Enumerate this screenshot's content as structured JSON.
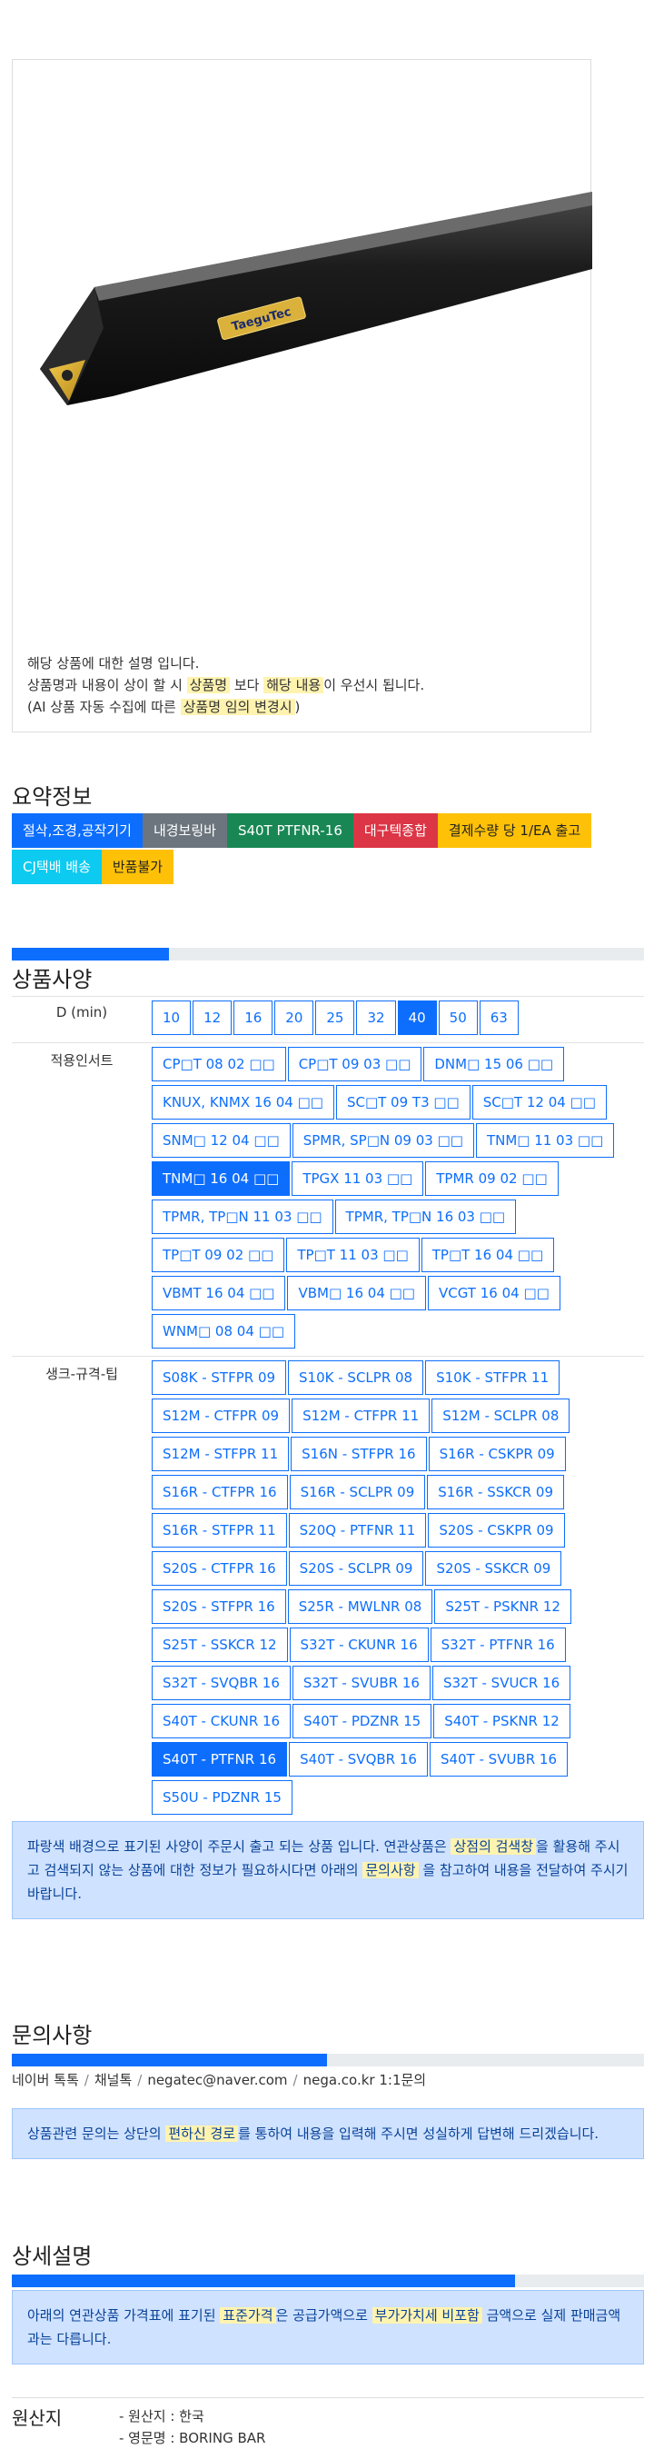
{
  "product": {
    "brand": "TaeguTec",
    "desc_line1": "해당 상품에 대한 설명 입니다.",
    "desc_line2_a": "상품명과 내용이 상이 할 시",
    "desc_line2_hl1": "상품명",
    "desc_line2_b": "보다",
    "desc_line2_hl2": "해당 내용",
    "desc_line2_c": "이 우선시 됩니다.",
    "desc_line3_a": "(AI 상품 자동 수집에 따른",
    "desc_line3_hl": "상품명 임의 변경시",
    "desc_line3_b": ")"
  },
  "summary": {
    "title": "요약정보",
    "badges": [
      {
        "label": "절삭,조경,공작기기",
        "color": "#0d6efd"
      },
      {
        "label": "내경보링바",
        "color": "#6c757d"
      },
      {
        "label": "S40T PTFNR-16",
        "color": "#198754"
      },
      {
        "label": "대구텍종합",
        "color": "#dc3545"
      },
      {
        "label": "결제수량 당 1/EA 출고",
        "color": "#ffc107",
        "text": "#222"
      },
      {
        "label": "CJ택배 배송",
        "color": "#0dcaf0"
      },
      {
        "label": "반품불가",
        "color": "#ffc107",
        "text": "#222"
      }
    ]
  },
  "specs": {
    "title": "상품사양",
    "d_label": "D (min)",
    "d_values": [
      "10",
      "12",
      "16",
      "20",
      "25",
      "32",
      "40",
      "50",
      "63"
    ],
    "d_selected": "40",
    "insert_label": "적용인서트",
    "inserts": [
      "CP□T 08 02 □□",
      "CP□T 09 03 □□",
      "DNM□ 15 06 □□",
      "KNUX, KNMX 16 04 □□",
      "SC□T 09 T3 □□",
      "SC□T 12 04 □□",
      "SNM□ 12 04 □□",
      "SPMR, SP□N 09 03 □□",
      "TNM□ 11 03 □□",
      "TNM□ 16 04 □□",
      "TPGX 11 03 □□",
      "TPMR 09 02 □□",
      "TPMR, TP□N 11 03 □□",
      "TPMR, TP□N 16 03 □□",
      "TP□T 09 02 □□",
      "TP□T 11 03 □□",
      "TP□T 16 04 □□",
      "VBMT 16 04 □□",
      "VBM□ 16 04 □□",
      "VCGT 16 04 □□",
      "WNM□ 08 04 □□"
    ],
    "insert_selected": "TNM□ 16 04 □□",
    "shank_label": "생크-규격-팁",
    "shanks": [
      "S08K - STFPR 09",
      "S10K - SCLPR 08",
      "S10K - STFPR 11",
      "S12M - CTFPR 09",
      "S12M - CTFPR 11",
      "S12M - SCLPR 08",
      "S12M - STFPR 11",
      "S16N - STFPR 16",
      "S16R - CSKPR 09",
      "S16R - CTFPR 16",
      "S16R - SCLPR 09",
      "S16R - SSKCR 09",
      "S16R - STFPR 11",
      "S20Q - PTFNR 11",
      "S20S - CSKPR 09",
      "S20S - CTFPR 16",
      "S20S - SCLPR 09",
      "S20S - SSKCR 09",
      "S20S - STFPR 16",
      "S25R - MWLNR 08",
      "S25T - PSKNR 12",
      "S25T - SSKCR 12",
      "S32T - CKUNR 16",
      "S32T - PTFNR 16",
      "S32T - SVQBR 16",
      "S32T - SVUBR 16",
      "S32T - SVUCR 16",
      "S40T - CKUNR 16",
      "S40T - PDZNR 15",
      "S40T - PSKNR 12",
      "S40T - PTFNR 16",
      "S40T - SVQBR 16",
      "S40T - SVUBR 16",
      "S50U - PDZNR 15"
    ],
    "shank_selected": "S40T - PTFNR 16",
    "note_a": "파랑색 배경으로 표기된 사양이 주문시 출고 되는 상품 입니다. 연관상품은",
    "note_hl1": "상점의 검색창",
    "note_b": "을 활용해 주시고 검색되지 않는 상품에 대한 정보가 필요하시다면 아래의",
    "note_hl2": "문의사항",
    "note_c": "을 참고하여 내용을 전달하여 주시기 바랍니다."
  },
  "inquiry": {
    "title": "문의사항",
    "links": [
      "네이버 톡톡",
      "채널톡",
      "negatec@naver.com",
      "nega.co.kr 1:1문의"
    ],
    "note_a": "상품관련 문의는 상단의",
    "note_hl": "편하신 경로",
    "note_b": "를 통하여 내용을 입력해 주시면 성실하게 답변해 드리겠습니다."
  },
  "detail": {
    "title": "상세설명",
    "note_a": "아래의 연관상품 가격표에 표기된",
    "note_hl1": "표준가격",
    "note_b": "은 공급가액으로",
    "note_hl2": "부가가치세 비포함",
    "note_c": "금액으로 실제 판매금액과는 다릅니다."
  },
  "origin": {
    "label": "원산지",
    "line1": "- 원산지 : 한국",
    "line2": "- 영문명 : BORING BAR"
  }
}
